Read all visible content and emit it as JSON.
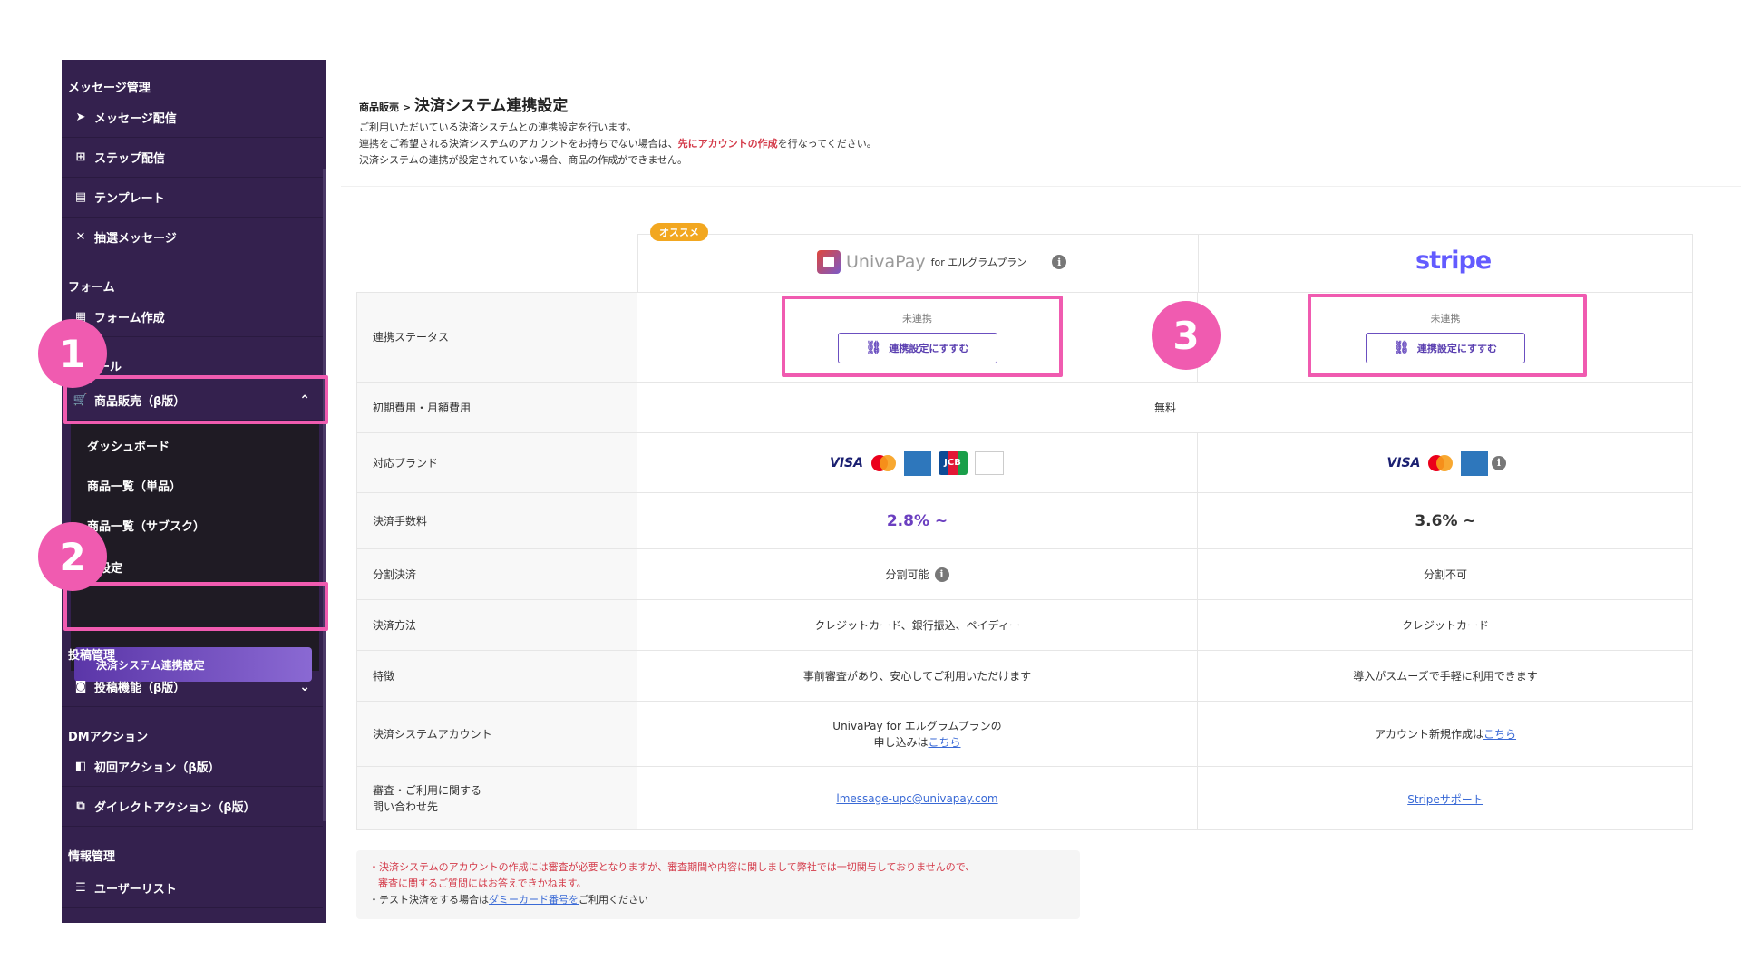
{
  "sidebar": {
    "sections": [
      {
        "title": "メッセージ管理"
      },
      {
        "title": "フォーム"
      },
      {
        "title": "ール"
      },
      {
        "title": "投稿管理"
      },
      {
        "title": "DMアクション"
      },
      {
        "title": "情報管理"
      }
    ],
    "items": {
      "message_send": "メッセージ配信",
      "step_send": "ステップ配信",
      "template": "テンプレート",
      "lottery": "抽選メッセージ",
      "form_create": "フォーム作成",
      "product_sales": "商品販売（β版）",
      "post_feature": "投稿機能（β版）",
      "first_action": "初回アクション（β版）",
      "direct_action": "ダイレクトアクション（β版）",
      "user_list": "ユーザーリスト"
    },
    "submenu": {
      "dashboard": "ダッシュボード",
      "product_single": "商品一覧（単品）",
      "product_sub": "商品一覧（サブスク）",
      "settings": "種設定",
      "payment_link": "決済システム連携設定"
    }
  },
  "annotations": {
    "one": "1",
    "two": "2",
    "three": "3"
  },
  "page": {
    "breadcrumb_parent": "商品販売",
    "breadcrumb_sep": " > ",
    "title": "決済システム連携設定",
    "desc1": "ご利用いただいている決済システムとの連携設定を行います。",
    "desc2_a": "連携をご希望される決済システムのアカウントをお持ちでない場合は、",
    "desc2_red": "先にアカウントの作成",
    "desc2_b": "を行なってください。",
    "desc3": "決済システムの連携が設定されていない場合、商品の作成ができません。"
  },
  "providers": {
    "recommend_badge": "オススメ",
    "univa_name": "UnivaPay",
    "univa_sub": "for エルグラムプラン",
    "stripe_name": "stripe",
    "info": "i"
  },
  "table": {
    "labels": {
      "status": "連携ステータス",
      "fee": "初期費用・月額費用",
      "brands": "対応ブランド",
      "rate": "決済手数料",
      "installment": "分割決済",
      "method": "決済方法",
      "feature": "特徴",
      "account": "決済システムアカウント",
      "contact1": "審査・ご利用に関する",
      "contact2": "問い合わせ先"
    },
    "univa": {
      "status": "未連携",
      "button": "連携設定にすすむ",
      "rate": "2.8% ~",
      "installment": "分割可能",
      "method": "クレジットカード、銀行振込、ペイディー",
      "feature": "事前審査があり、安心してご利用いただけます",
      "account1": "UnivaPay for エルグラムプランの",
      "account2_a": "申し込みは",
      "account2_link": "こちら",
      "contact": "lmessage-upc@univapay.com"
    },
    "stripe": {
      "status": "未連携",
      "button": "連携設定にすすむ",
      "rate": "3.6% ~",
      "installment": "分割不可",
      "method": "クレジットカード",
      "feature": "導入がスムーズで手軽に利用できます",
      "account_a": "アカウント新規作成は",
      "account_link": "こちら",
      "contact": "Stripeサポート"
    },
    "fee_common": "無料",
    "brand_names": {
      "visa": "VISA",
      "jcb": "JCB",
      "amex": "AMERICAN EXPRESS",
      "diners": "Diners Club"
    }
  },
  "notes": {
    "line1": "・決済システムのアカウントの作成には審査が必要となりますが、審査期間や内容に関しまして弊社では一切関与しておりませんので、",
    "line2": "審査に関するご質問にはお答えできかねます。",
    "line3_a": "・テスト決済をする場合は",
    "line3_link": "ダミーカード番号を",
    "line3_b": "ご利用ください"
  },
  "colors": {
    "accent": "#6b4fc0",
    "highlight": "#f05bb0",
    "sidebar": "#34214e",
    "recommend": "#f2a720"
  }
}
